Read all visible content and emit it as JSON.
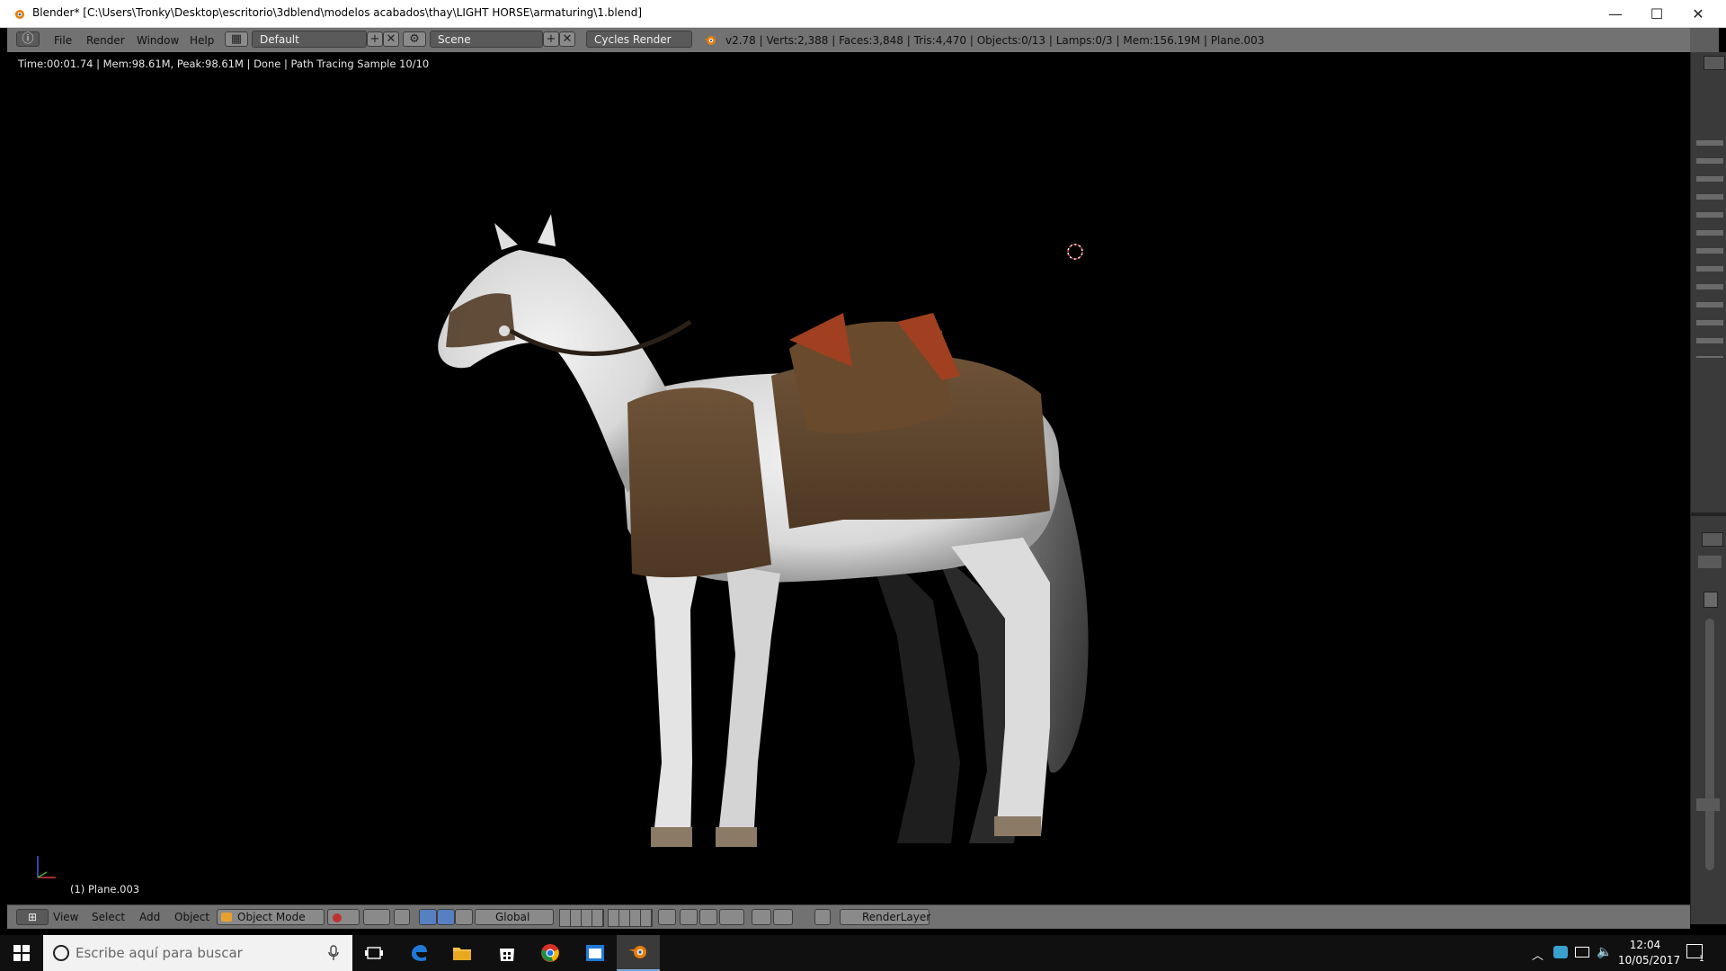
{
  "window": {
    "title": "Blender* [C:\\Users\\Tronky\\Desktop\\escritorio\\3dblend\\modelos acabados\\thay\\LIGHT HORSE\\armaturing\\1.blend]",
    "minimize": "—",
    "maximize": "☐",
    "close": "✕"
  },
  "info_header": {
    "menus": [
      "File",
      "Render",
      "Window",
      "Help"
    ],
    "screen_layout": "Default",
    "scene": "Scene",
    "render_engine": "Cycles Render",
    "stats": "v2.78 | Verts:2,388 | Faces:3,848 | Tris:4,470 | Objects:0/13 | Lamps:0/3 | Mem:156.19M | Plane.003"
  },
  "viewport": {
    "render_info": "Time:00:01.74 | Mem:98.61M, Peak:98.61M | Done | Path Tracing Sample 10/10",
    "active_object": "(1) Plane.003"
  },
  "view_header": {
    "menus": [
      "View",
      "Select",
      "Add",
      "Object"
    ],
    "mode": "Object Mode",
    "orientation": "Global",
    "render_layer": "RenderLayer"
  },
  "taskbar": {
    "search_placeholder": "Escribe aquí para buscar",
    "time": "12:04",
    "date": "10/05/2017",
    "notification_count": "1"
  },
  "colors": {
    "header_bg": "#727272",
    "viewport_bg": "#000000",
    "taskbar_bg": "#101010",
    "blender_orange": "#e87d0d"
  }
}
